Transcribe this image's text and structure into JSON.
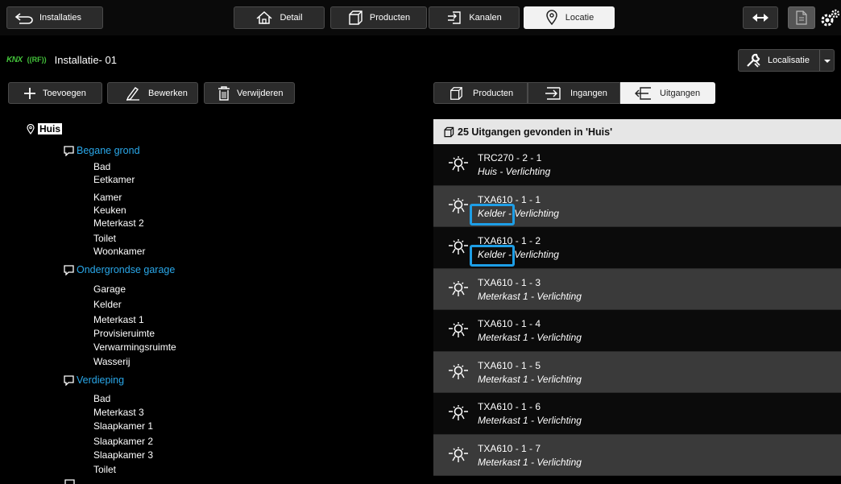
{
  "topbar": {
    "back_label": "Installaties",
    "tabs": [
      {
        "label": "Detail",
        "icon": "home-icon"
      },
      {
        "label": "Producten",
        "icon": "cube-icon"
      },
      {
        "label": "Kanalen",
        "icon": "channel-icon"
      },
      {
        "label": "Locatie",
        "icon": "location-pin-icon",
        "active": true
      }
    ]
  },
  "installation": {
    "knx": "KNX",
    "rf": "((RF))",
    "name": "Installatie- 01"
  },
  "localisatie_label": "Localisatie",
  "actions": {
    "add": "Toevoegen",
    "edit": "Bewerken",
    "delete": "Verwijderen"
  },
  "tree": {
    "root": "Huis",
    "floors": [
      {
        "name": "Begane grond",
        "rooms": [
          "Bad",
          "Eetkamer",
          "Kamer",
          "Keuken",
          "Meterkast 2",
          "Toilet",
          "Woonkamer"
        ]
      },
      {
        "name": "Ondergrondse garage",
        "rooms": [
          "Garage",
          "Kelder",
          "Meterkast 1",
          "Provisieruimte",
          "Verwarmingsruimte",
          "Wasserij"
        ]
      },
      {
        "name": "Verdieping",
        "rooms": [
          "Bad",
          "Meterkast 3",
          "Slaapkamer 1",
          "Slaapkamer 2",
          "Slaapkamer 3",
          "Toilet"
        ]
      }
    ]
  },
  "right_tabs": [
    {
      "label": "Producten",
      "icon": "cube-icon"
    },
    {
      "label": "Ingangen",
      "icon": "input-icon"
    },
    {
      "label": "Uitgangen",
      "icon": "output-icon",
      "active": true
    }
  ],
  "list": {
    "header": "25 Uitgangen gevonden in 'Huis'",
    "items": [
      {
        "name": "TRC270 - 2 - 1",
        "location": "Huis - Verlichting"
      },
      {
        "name": "TXA610 - 1 - 1",
        "location": "Kelder - Verlichting"
      },
      {
        "name": "TXA610 - 1 - 2",
        "location": "Kelder - Verlichting"
      },
      {
        "name": "TXA610 - 1 - 3",
        "location": "Meterkast 1 - Verlichting"
      },
      {
        "name": "TXA610 - 1 - 4",
        "location": "Meterkast 1 - Verlichting"
      },
      {
        "name": "TXA610 - 1 - 5",
        "location": "Meterkast 1 - Verlichting"
      },
      {
        "name": "TXA610 - 1 - 6",
        "location": "Meterkast 1 - Verlichting"
      },
      {
        "name": "TXA610 - 1 - 7",
        "location": "Meterkast 1 - Verlichting"
      }
    ]
  },
  "colors": {
    "accent_blue": "#2aa8ea",
    "highlight": "#1e9ee6",
    "knx_green": "#43c23a"
  }
}
